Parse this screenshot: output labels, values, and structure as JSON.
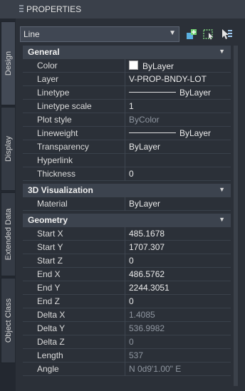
{
  "panel": {
    "title": "PROPERTIES"
  },
  "tabs": [
    "Design",
    "Display",
    "Extended Data",
    "Object Class"
  ],
  "selector": {
    "value": "Line"
  },
  "toolbar": [
    "quick-select-icon",
    "select-objects-icon",
    "toggle-pickadd-icon"
  ],
  "colors": {
    "panel_bg": "#2b3038",
    "section_bg": "#3c434e",
    "titlebar_bg": "#3a404a"
  },
  "sections": {
    "general": {
      "title": "General",
      "rows": [
        {
          "key": "Color",
          "value": "ByLayer"
        },
        {
          "key": "Layer",
          "value": "V-PROP-BNDY-LOT"
        },
        {
          "key": "Linetype",
          "value": "ByLayer"
        },
        {
          "key": "Linetype scale",
          "value": "1"
        },
        {
          "key": "Plot style",
          "value": "ByColor"
        },
        {
          "key": "Lineweight",
          "value": "ByLayer"
        },
        {
          "key": "Transparency",
          "value": "ByLayer"
        },
        {
          "key": "Hyperlink",
          "value": ""
        },
        {
          "key": "Thickness",
          "value": "0"
        }
      ]
    },
    "visualization": {
      "title": "3D Visualization",
      "rows": [
        {
          "key": "Material",
          "value": "ByLayer"
        }
      ]
    },
    "geometry": {
      "title": "Geometry",
      "rows": [
        {
          "key": "Start X",
          "value": "485.1678"
        },
        {
          "key": "Start Y",
          "value": "1707.307"
        },
        {
          "key": "Start Z",
          "value": "0"
        },
        {
          "key": "End X",
          "value": "486.5762"
        },
        {
          "key": "End Y",
          "value": "2244.3051"
        },
        {
          "key": "End Z",
          "value": "0"
        },
        {
          "key": "Delta X",
          "value": "1.4085"
        },
        {
          "key": "Delta Y",
          "value": "536.9982"
        },
        {
          "key": "Delta Z",
          "value": "0"
        },
        {
          "key": "Length",
          "value": "537"
        },
        {
          "key": "Angle",
          "value": "N 0d9'1.00\" E"
        }
      ]
    }
  }
}
